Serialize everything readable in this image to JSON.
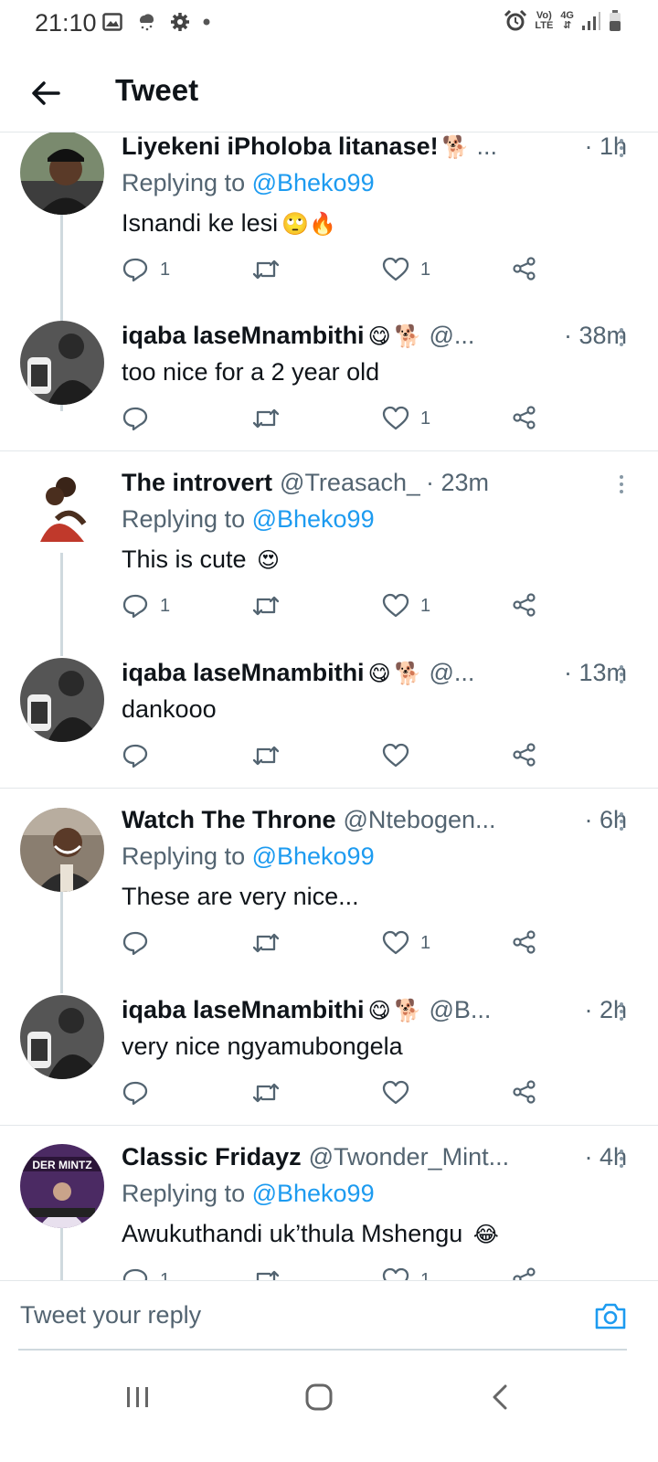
{
  "status_bar": {
    "time": "21:10",
    "icons": [
      "gallery-icon",
      "weather-icon",
      "settings-icon",
      "dot-icon",
      "alarm-icon",
      "volte-icon",
      "4g-icon",
      "signal-icon",
      "battery-icon"
    ],
    "volte_top": "Vo)",
    "volte_bottom": "LTE",
    "network_type": "4G"
  },
  "header": {
    "title": "Tweet"
  },
  "tweets": [
    {
      "name": "Liyekeni iPholoba litanase!",
      "emojis": [
        "🐕"
      ],
      "handle": "...",
      "time": "· 1h",
      "replying_prefix": "Replying to ",
      "replying_to": "@Bheko99",
      "text": "Isnandi ke lesi",
      "text_emojis": "🙄🔥",
      "reply_count": "1",
      "retweet_count": "",
      "like_count": "1"
    },
    {
      "name": "iqaba laseMnambithi",
      "emojis": [
        "😋",
        "🐕"
      ],
      "handle": "@...",
      "time": "· 38m",
      "text": "too nice for a 2 year old",
      "reply_count": "",
      "retweet_count": "",
      "like_count": "1"
    },
    {
      "name": "The introvert",
      "emojis": [],
      "handle": "@Treasach_",
      "time": "· 23m",
      "replying_prefix": "Replying to ",
      "replying_to": "@Bheko99",
      "text": "This is cute ",
      "text_emojis": "😍",
      "reply_count": "1",
      "retweet_count": "",
      "like_count": "1"
    },
    {
      "name": "iqaba laseMnambithi",
      "emojis": [
        "😋",
        "🐕"
      ],
      "handle": "@...",
      "time": "· 13m",
      "text": "dankooo",
      "reply_count": "",
      "retweet_count": "",
      "like_count": ""
    },
    {
      "name": "Watch The Throne",
      "emojis": [],
      "handle": "@Ntebogen...",
      "time": "· 6h",
      "replying_prefix": "Replying to ",
      "replying_to": "@Bheko99",
      "text": "These are very nice...",
      "reply_count": "",
      "retweet_count": "",
      "like_count": "1"
    },
    {
      "name": "iqaba laseMnambithi",
      "emojis": [
        "😋",
        "🐕"
      ],
      "handle": "@B...",
      "time": "· 2h",
      "text": "very nice ngyamubongela",
      "reply_count": "",
      "retweet_count": "",
      "like_count": ""
    },
    {
      "name": "Classic Fridayz",
      "emojis": [],
      "handle": "@Twonder_Mint...",
      "time": "· 4h",
      "replying_prefix": "Replying to ",
      "replying_to": "@Bheko99",
      "text": "Awukuthandi uk’thula Mshengu ",
      "text_emojis": "😂",
      "avatar_text": "DER MINTZ",
      "reply_count": "1",
      "retweet_count": "",
      "like_count": "1"
    }
  ],
  "reply_bar": {
    "placeholder": "Tweet your reply"
  },
  "colors": {
    "accent": "#1d9bf0",
    "text_primary": "#0f1419",
    "text_secondary": "#536471",
    "divider": "#e3e7ea",
    "thread_line": "#cfd9de"
  }
}
